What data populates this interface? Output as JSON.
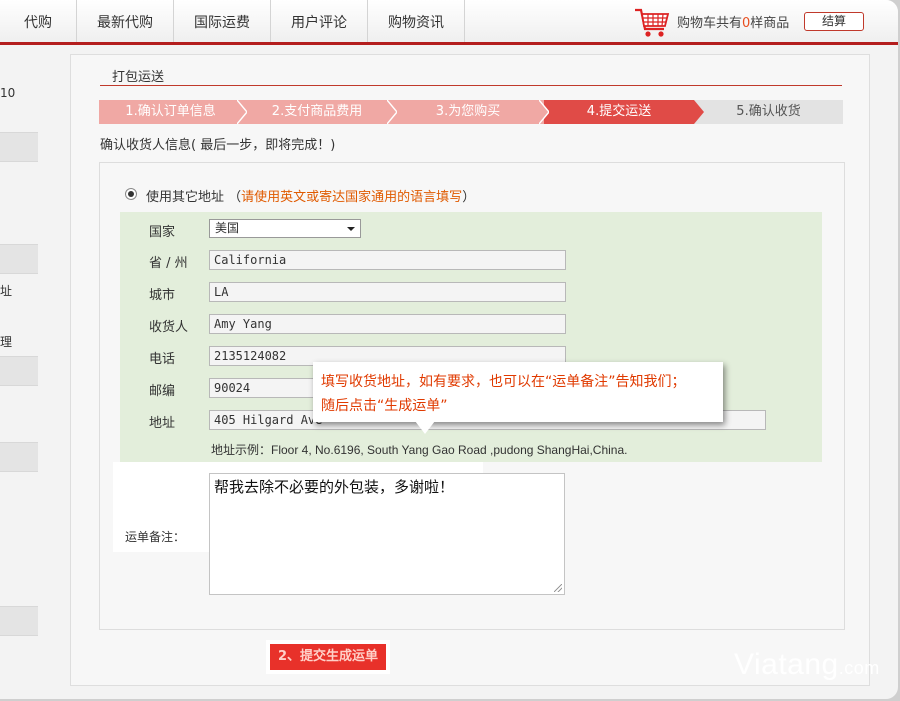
{
  "nav": {
    "items": [
      "代购",
      "最新代购",
      "国际运费",
      "用户评论",
      "购物资讯"
    ],
    "cart_prefix": "购物车共有",
    "cart_count": "0",
    "cart_suffix": "样商品",
    "checkout": "结算"
  },
  "sidebar": {
    "texts": [
      "10",
      "址",
      "理"
    ]
  },
  "section": {
    "title": "打包运送"
  },
  "steps": [
    {
      "label": "1.确认订单信息",
      "state": "done"
    },
    {
      "label": "2.支付商品费用",
      "state": "done"
    },
    {
      "label": "3.为您购买",
      "state": "done"
    },
    {
      "label": "4.提交运送",
      "state": "current"
    },
    {
      "label": "5.确认收货",
      "state": "future"
    }
  ],
  "confirm_note": "确认收货人信息( 最后一步，即将完成！)",
  "address": {
    "option_label": "使用其它地址",
    "option_hint": "请使用英文或寄达国家通用的语言填写",
    "fields": {
      "country": {
        "label": "国家",
        "value": "美国"
      },
      "state": {
        "label": "省 / 州",
        "value": "California"
      },
      "city": {
        "label": "城市",
        "value": "LA"
      },
      "recipient": {
        "label": "收货人",
        "value": "Amy Yang"
      },
      "phone": {
        "label": "电话",
        "value": "2135124082"
      },
      "zip": {
        "label": "邮编",
        "value": "90024"
      },
      "street": {
        "label": "地址",
        "value": "405 Hilgard Ave"
      }
    },
    "example": "地址示例：Floor 4, No.6196, South Yang Gao Road ,pudong ShangHai,China."
  },
  "note": {
    "label": "运单备注：",
    "value": "帮我去除不必要的外包装，多谢啦！"
  },
  "callout": {
    "line1": "填写收货地址，如有要求，也可以在“运单备注”告知我们；",
    "line2": "随后点击“生成运单”"
  },
  "submit": "2、提交生成运单",
  "watermark": {
    "brand": "Viatang",
    "suffix": ".com"
  },
  "colors": {
    "accent": "#b41e1e",
    "step_current": "#e04b47",
    "step_done": "#f0a8a4",
    "hint": "#e05a00",
    "button": "#e8312a"
  }
}
